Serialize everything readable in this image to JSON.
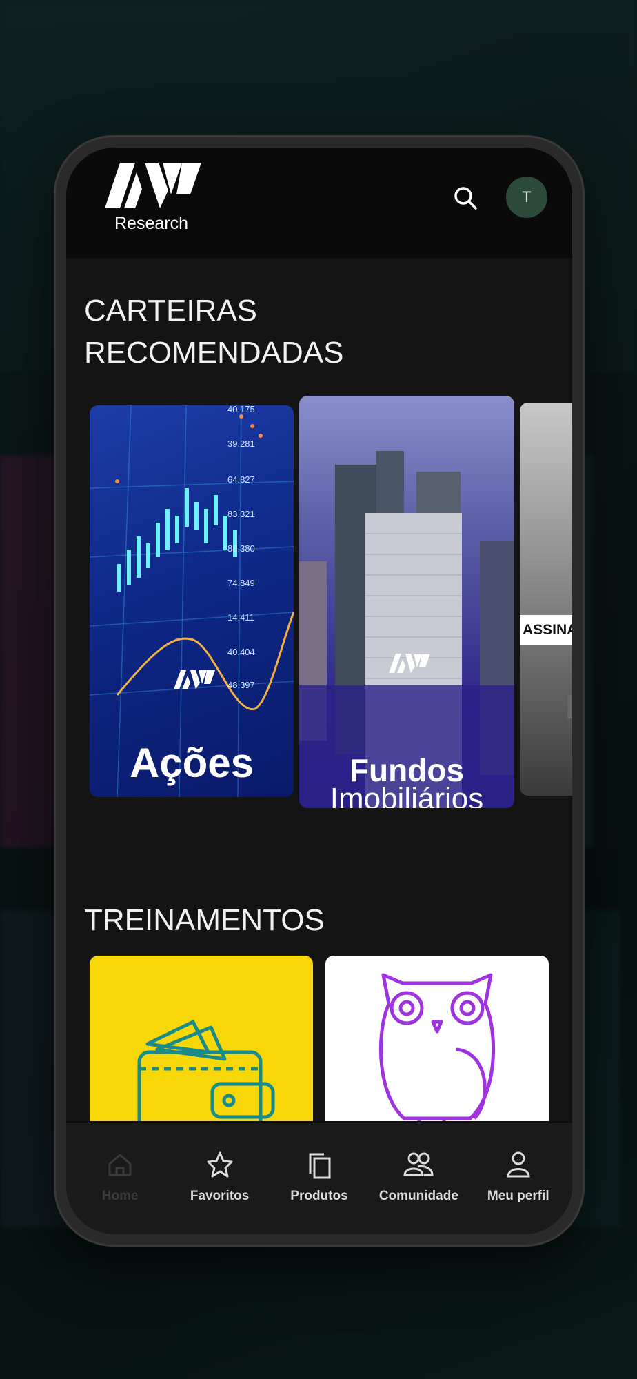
{
  "header": {
    "logo_text": "Research",
    "avatar_initial": "T",
    "search_icon": "search-icon"
  },
  "sections": {
    "carteiras_title": "CARTEIRAS RECOMENDADAS",
    "treinamentos_title": "TREINAMENTOS"
  },
  "carteiras": [
    {
      "label": "Ações"
    },
    {
      "label_line1": "Fundos",
      "label_line2": "Imobiliários"
    },
    {
      "badge": "ASSINA",
      "letter": "F"
    }
  ],
  "chart_ticks": [
    "40.175",
    "39.281",
    "64.827",
    "83.321",
    "88.380",
    "74.849",
    "14.411",
    "40.404",
    "48.397"
  ],
  "nav": [
    {
      "label": "Home",
      "icon": "home-icon",
      "active": true
    },
    {
      "label": "Favoritos",
      "icon": "star-icon"
    },
    {
      "label": "Produtos",
      "icon": "copy-icon"
    },
    {
      "label": "Comunidade",
      "icon": "people-icon"
    },
    {
      "label": "Meu perfil",
      "icon": "user-icon"
    }
  ],
  "colors": {
    "accent_yellow": "#f8d708",
    "owl_purple": "#a033e0",
    "wallet_teal": "#1a8b8b"
  }
}
